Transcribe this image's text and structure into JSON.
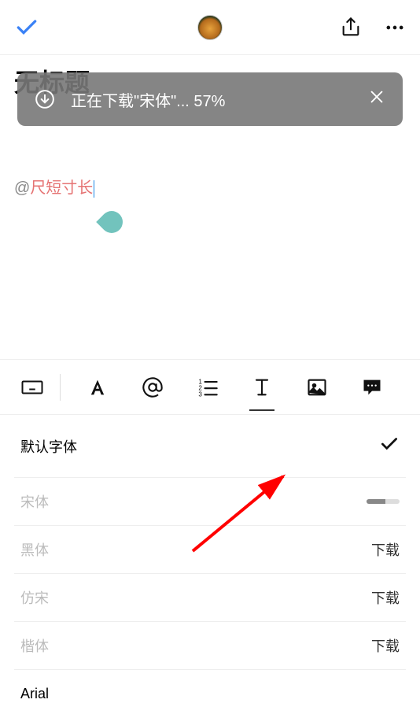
{
  "page": {
    "title": "无标题"
  },
  "toast": {
    "text": "正在下载\"宋体\"... 57%"
  },
  "mention": {
    "at": "@",
    "name": "尺短寸长"
  },
  "fonts": [
    {
      "label": "默认字体",
      "state": "selected",
      "action": ""
    },
    {
      "label": "宋体",
      "state": "downloading",
      "action": ""
    },
    {
      "label": "黑体",
      "state": "available",
      "action": "下载"
    },
    {
      "label": "仿宋",
      "state": "available",
      "action": "下载"
    },
    {
      "label": "楷体",
      "state": "available",
      "action": "下载"
    },
    {
      "label": "Arial",
      "state": "installed",
      "action": ""
    }
  ],
  "download_progress_percent": 57
}
